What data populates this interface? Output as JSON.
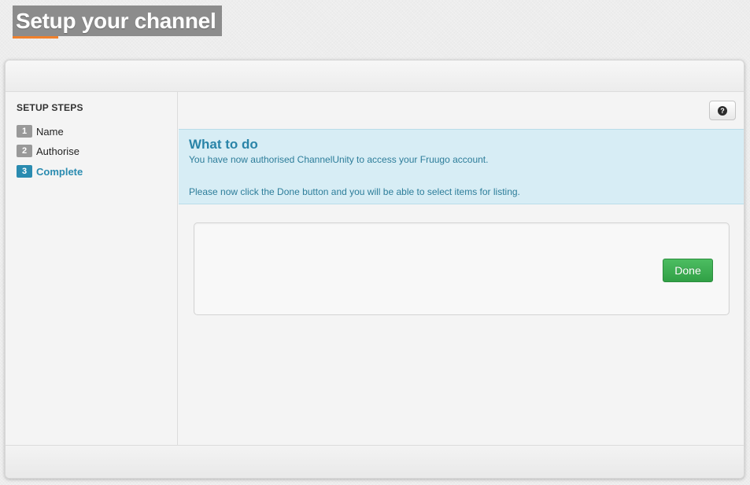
{
  "page": {
    "title": "Setup your channel"
  },
  "sidebar": {
    "heading": "SETUP STEPS",
    "steps": [
      {
        "number": "1",
        "label": "Name",
        "active": false
      },
      {
        "number": "2",
        "label": "Authorise",
        "active": false
      },
      {
        "number": "3",
        "label": "Complete",
        "active": true
      }
    ]
  },
  "help": {
    "icon": "question-circle-icon",
    "glyph": "?"
  },
  "info": {
    "title": "What to do",
    "line1": "You have now authorised ChannelUnity to access your Fruugo account.",
    "line2": "Please now click the Done button and you will be able to select items for listing."
  },
  "actions": {
    "done_label": "Done"
  },
  "colors": {
    "accent": "#2a8bb0",
    "title_underline": "#f0802c",
    "done_button": "#3cae51",
    "info_bg": "#d7edf5"
  }
}
